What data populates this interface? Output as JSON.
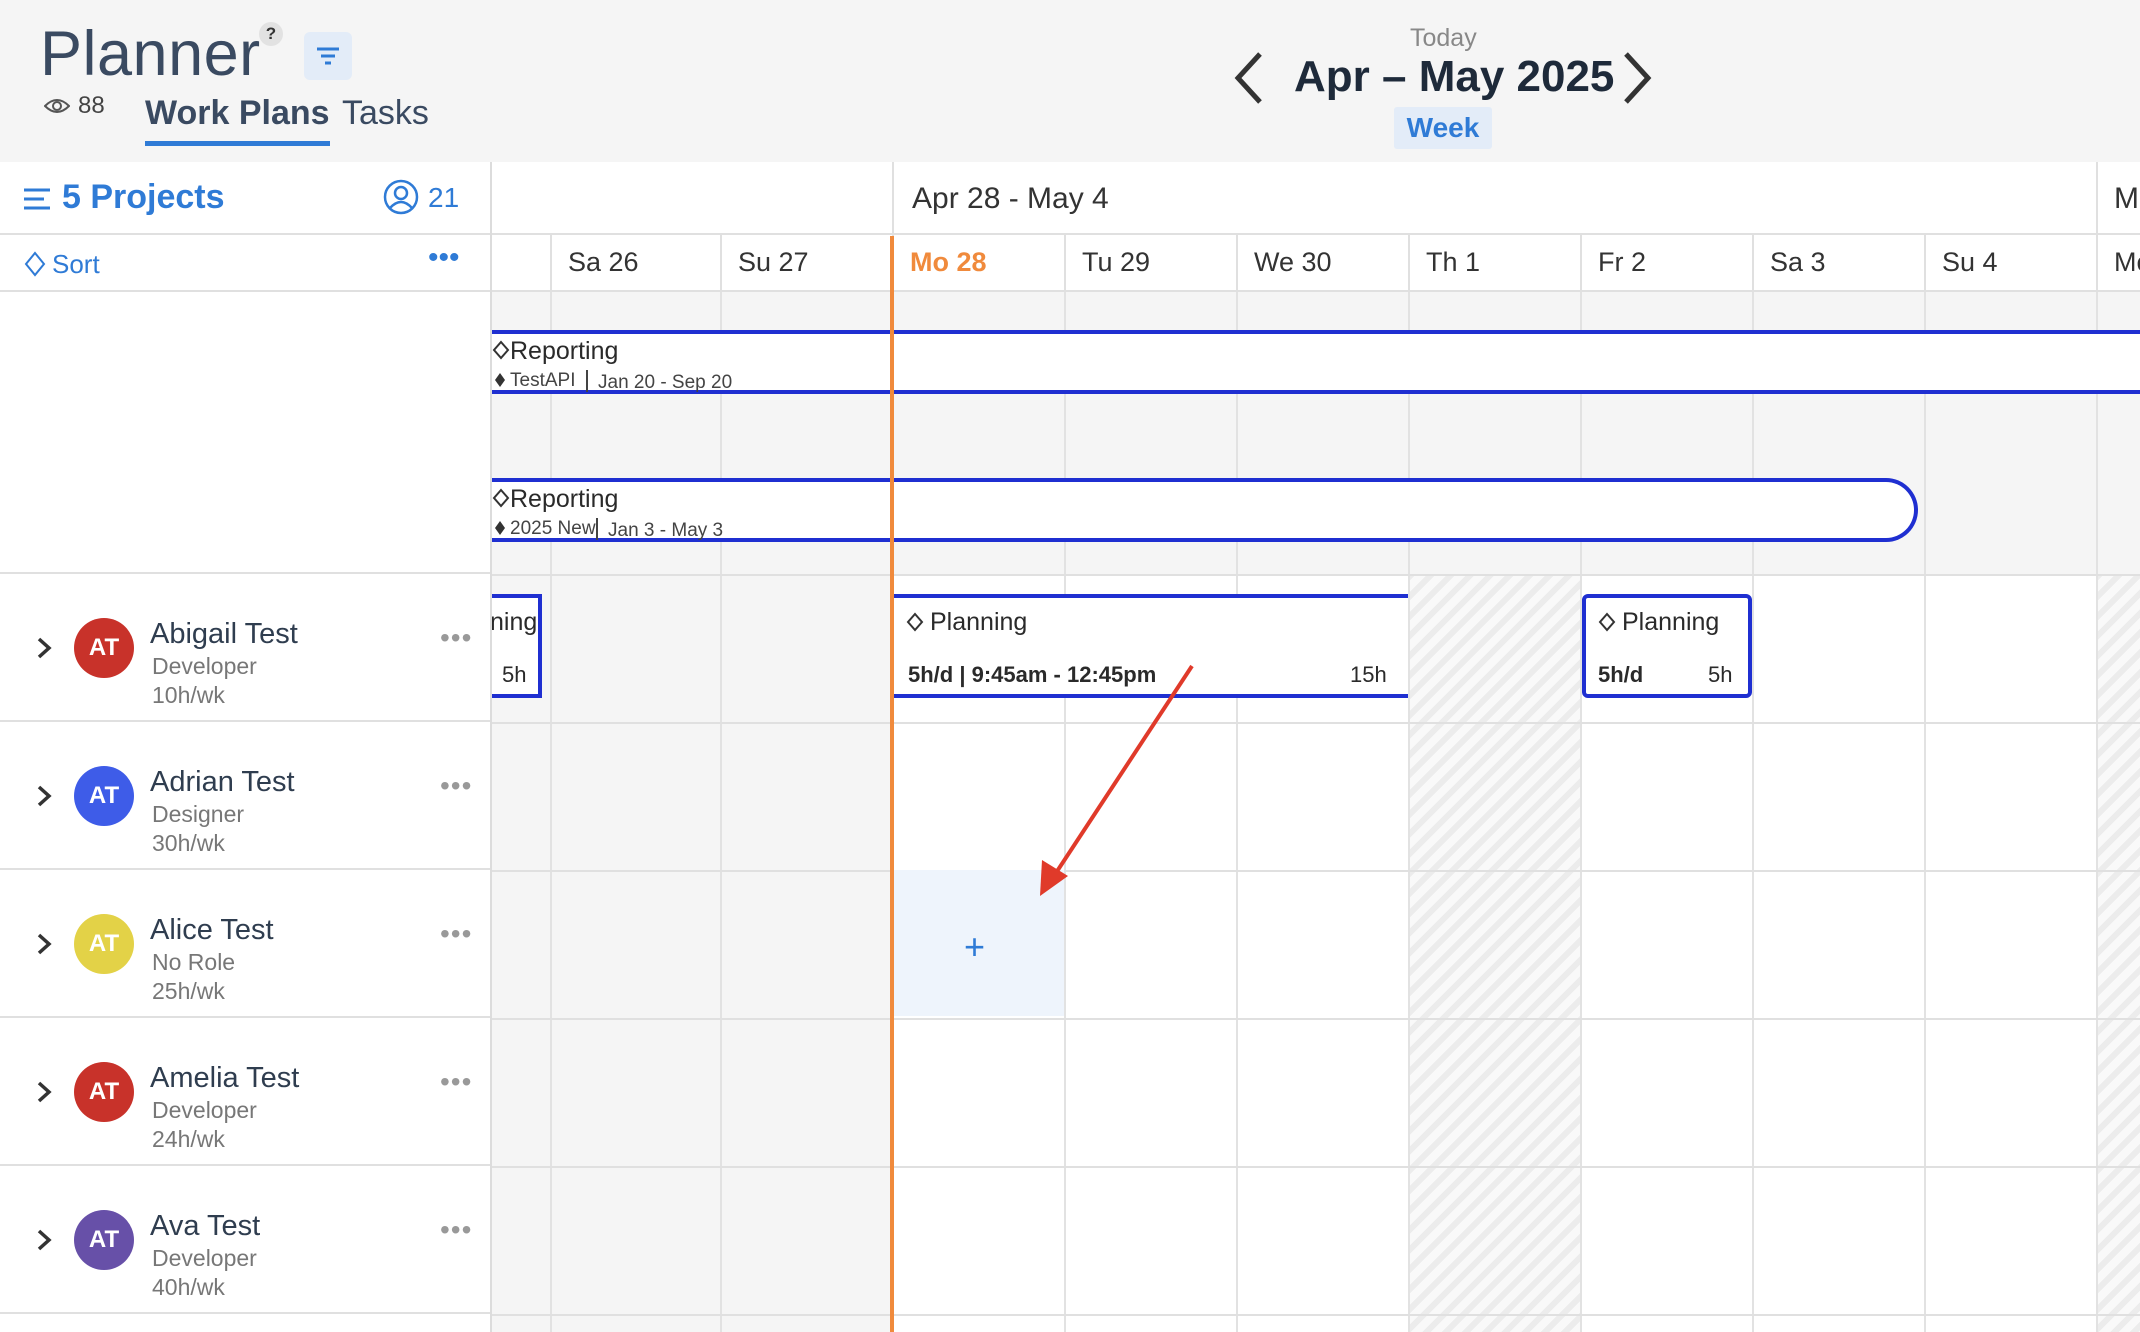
{
  "header": {
    "title": "Planner",
    "help": "?",
    "views": "88",
    "tabs": [
      "Work Plans",
      "Tasks"
    ],
    "today": "Today",
    "range": "Apr – May 2025",
    "view_mode": "Week"
  },
  "sidebar": {
    "projects_label": "5 Projects",
    "people_count": "21",
    "sort_label": "Sort",
    "people": [
      {
        "initials": "AT",
        "name": "Abigail Test",
        "role": "Developer",
        "hours": "10h/wk",
        "color": "#c8322a"
      },
      {
        "initials": "AT",
        "name": "Adrian Test",
        "role": "Designer",
        "hours": "30h/wk",
        "color": "#3e5ce8"
      },
      {
        "initials": "AT",
        "name": "Alice Test",
        "role": "No Role",
        "hours": "25h/wk",
        "color": "#e3d247"
      },
      {
        "initials": "AT",
        "name": "Amelia Test",
        "role": "Developer",
        "hours": "24h/wk",
        "color": "#c8322a"
      },
      {
        "initials": "AT",
        "name": "Ava Test",
        "role": "Developer",
        "hours": "40h/wk",
        "color": "#6750a8"
      }
    ]
  },
  "calendar": {
    "week_label": "Apr 28 - May 4",
    "next_week_label": "M",
    "days": [
      "Sa 26",
      "Su 27",
      "Mo 28",
      "Tu 29",
      "We 30",
      "Th 1",
      "Fr 2",
      "Sa 3",
      "Su 4",
      "Mo"
    ],
    "today_day": "Mo 28"
  },
  "projects": [
    {
      "title": "Reporting",
      "client": "TestAPI",
      "dates": "Jan 20 - Sep 20"
    },
    {
      "title": "Reporting",
      "client": "2025 New",
      "dates": "Jan 3 - May 3"
    }
  ],
  "work_plans": {
    "partial": {
      "title": "ning",
      "hours": "5h"
    },
    "plan_a": {
      "title": "Planning",
      "meta": "5h/d | 9:45am - 12:45pm",
      "total": "15h"
    },
    "plan_b": {
      "title": "Planning",
      "meta": "5h/d",
      "total": "5h"
    }
  },
  "colors": {
    "accent": "#2f7bd6",
    "bar_border": "#1f2fd1",
    "today": "#f08a3c",
    "annotation": "#e03a2a"
  }
}
